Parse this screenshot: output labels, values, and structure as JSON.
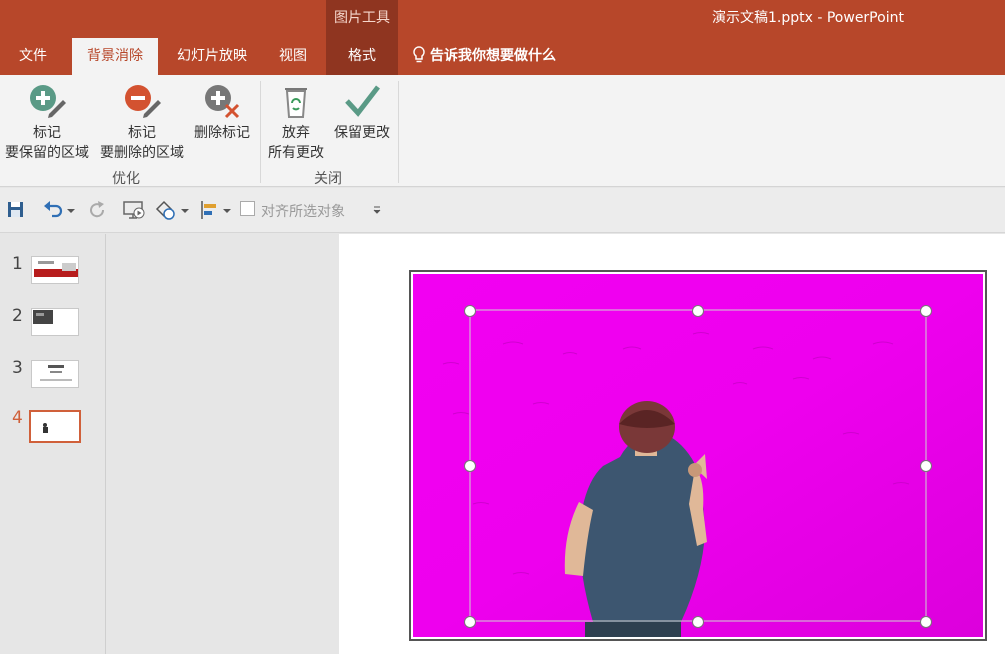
{
  "window": {
    "title": "演示文稿1.pptx  -  PowerPoint",
    "context_group": "图片工具"
  },
  "tabs": [
    {
      "label": "文件",
      "active": false
    },
    {
      "label": "背景消除",
      "active": true
    },
    {
      "label": "幻灯片放映",
      "active": false
    },
    {
      "label": "视图",
      "active": false
    },
    {
      "label": "格式",
      "active": false
    }
  ],
  "tell_me": "告诉我你想要做什么",
  "ribbon": {
    "mark_keep": {
      "line1": "标记",
      "line2": "要保留的区域"
    },
    "mark_remove": {
      "line1": "标记",
      "line2": "要删除的区域"
    },
    "delete_mark": {
      "line1": "删除标记"
    },
    "discard": {
      "line1": "放弃",
      "line2": "所有更改"
    },
    "keep": {
      "line1": "保留更改"
    },
    "groups": {
      "refine": "优化",
      "close": "关闭"
    }
  },
  "qat": {
    "align_label": "对齐所选对象"
  },
  "slides": [
    {
      "number": "1",
      "active": false
    },
    {
      "number": "2",
      "active": false
    },
    {
      "number": "3",
      "active": false
    },
    {
      "number": "4",
      "active": true
    }
  ],
  "colors": {
    "accent": "#b7472a",
    "removed_area": "#ee00ee",
    "keep_green": "#5a9a86",
    "remove_red": "#d35230"
  }
}
